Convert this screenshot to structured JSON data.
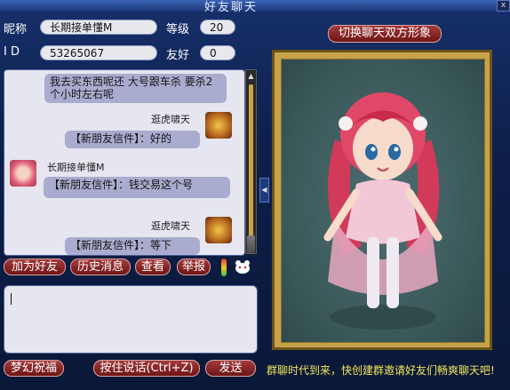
{
  "window": {
    "title": "好友聊天",
    "close_glyph": "x"
  },
  "profile": {
    "nickname_label": "昵称",
    "nickname": "长期接单懂M",
    "level_label": "等级",
    "level": "20",
    "id_label": "I D",
    "id": "53265067",
    "friendship_label": "友好",
    "friendship": "0"
  },
  "switch_button": "切换聊天双方形象",
  "chat": {
    "messages": [
      {
        "text": "我去买东西呢还 大号跟车杀 要杀2个小时左右呢",
        "side": "left"
      },
      {
        "sender": "逛虎啸天",
        "text": "【新朋友信件】：好的",
        "side": "right",
        "avatar": "tiger-avatar"
      },
      {
        "sender": "长期接单懂M",
        "text": "【新朋友信件】：钱交易这个号",
        "side": "left",
        "avatar": "girl-avatar"
      },
      {
        "sender": "逛虎啸天",
        "text": "【新朋友信件】：等下",
        "side": "right",
        "avatar": "tiger-avatar"
      }
    ]
  },
  "actions": {
    "add_friend": "加为好友",
    "history": "历史消息",
    "view": "查看",
    "report": "举报"
  },
  "bottom": {
    "dream_wish": "梦幻祝福",
    "voice": "按住说话(Ctrl+Z)",
    "send": "发送"
  },
  "footer_text": "群聊时代到来，快创建群邀请好友们畅爽聊天吧!",
  "colors": {
    "accent": "#8b1e1e",
    "panel": "#0d1f4a",
    "bubble": "#a9accf",
    "footer": "#f3e65a"
  }
}
